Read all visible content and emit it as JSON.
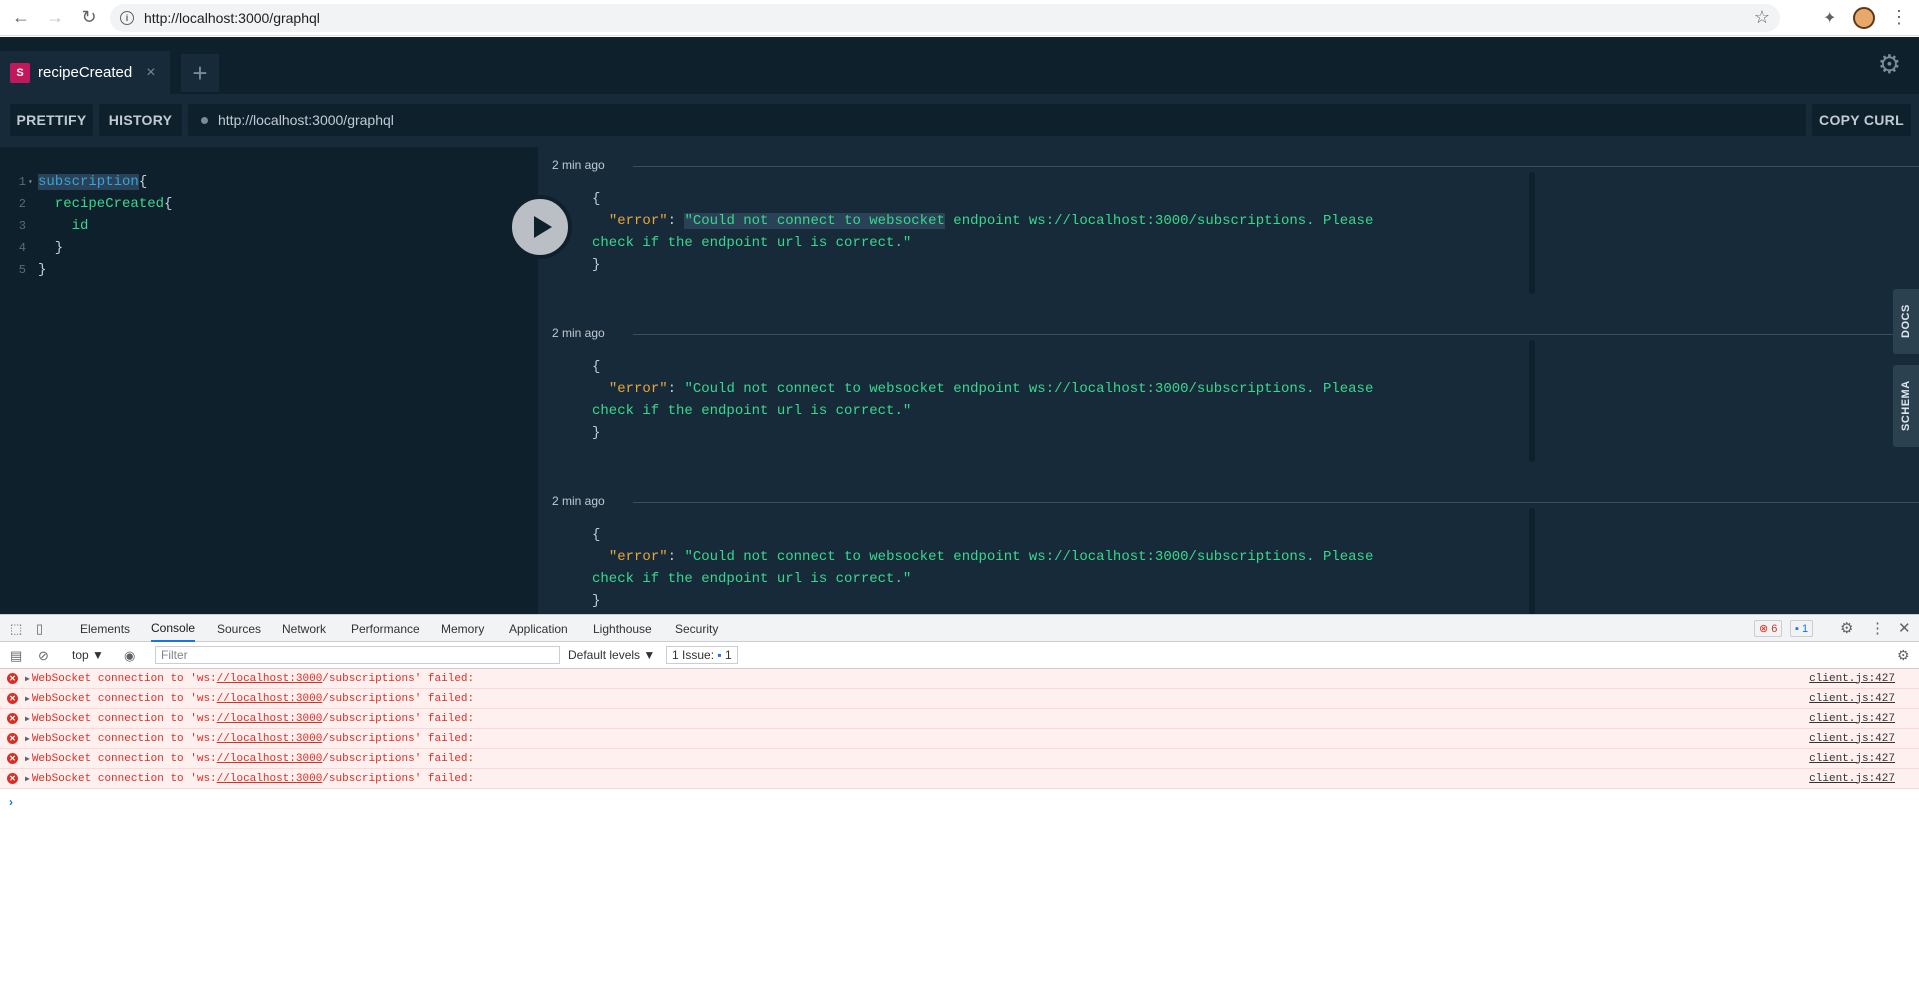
{
  "browser": {
    "back": "←",
    "forward": "→",
    "reload": "↻",
    "url": "http://localhost:3000/graphql",
    "star": "☆",
    "extensions": "✦",
    "menu": "⋮"
  },
  "playground": {
    "tab": {
      "badge": "S",
      "title": "recipeCreated",
      "close": "×"
    },
    "add_tab": "+",
    "settings": "⚙",
    "toolbar": {
      "prettify": "PRETTIFY",
      "history": "HISTORY",
      "endpoint": "http://localhost:3000/graphql",
      "copy_curl": "COPY CURL"
    },
    "editor": {
      "lines": [
        {
          "n": "1",
          "a": "subscription",
          "b": "{"
        },
        {
          "n": "2",
          "a": "  recipeCreated",
          "b": "{"
        },
        {
          "n": "3",
          "a": "    id",
          "b": ""
        },
        {
          "n": "4",
          "a": "  }",
          "b": ""
        },
        {
          "n": "5",
          "a": "}",
          "b": ""
        }
      ],
      "fold": "▾"
    },
    "results": [
      {
        "time": "2 min ago",
        "open": "{",
        "key": "\"error\"",
        "colon": ": ",
        "msg_part1": "\"Could not connect to websocket",
        "msg_part2": " endpoint ws://localhost:3000/subscriptions. Please",
        "msg_line2": "check if the endpoint url is correct.\"",
        "close": "}"
      },
      {
        "time": "2 min ago",
        "open": "{",
        "key": "\"error\"",
        "colon": ": ",
        "msg_part1": "\"Could not connect to websocket",
        "msg_part2": " endpoint ws://localhost:3000/subscriptions. Please",
        "msg_line2": "check if the endpoint url is correct.\"",
        "close": "}"
      },
      {
        "time": "2 min ago",
        "open": "{",
        "key": "\"error\"",
        "colon": ": ",
        "msg_part1": "\"Could not connect to websocket",
        "msg_part2": " endpoint ws://localhost:3000/subscriptions. Please",
        "msg_line2": "check if the endpoint url is correct.\"",
        "close": "}"
      }
    ],
    "side_tabs": {
      "docs": "DOCS",
      "schema": "SCHEMA"
    }
  },
  "devtools": {
    "tabs": [
      "Elements",
      "Console",
      "Sources",
      "Network",
      "Performance",
      "Memory",
      "Application",
      "Lighthouse",
      "Security"
    ],
    "active_tab": "Console",
    "error_count": "6",
    "message_count": "1",
    "context": "top ▼",
    "filter_placeholder": "Filter",
    "levels": "Default levels ▼",
    "issues_label": "1 Issue:",
    "issues_count": "1",
    "logs": [
      {
        "pre": "WebSocket connection to 'ws:",
        "link": "//localhost:3000",
        "post": "/subscriptions' failed:",
        "src": "client.js:427"
      },
      {
        "pre": "WebSocket connection to 'ws:",
        "link": "//localhost:3000",
        "post": "/subscriptions' failed:",
        "src": "client.js:427"
      },
      {
        "pre": "WebSocket connection to 'ws:",
        "link": "//localhost:3000",
        "post": "/subscriptions' failed:",
        "src": "client.js:427"
      },
      {
        "pre": "WebSocket connection to 'ws:",
        "link": "//localhost:3000",
        "post": "/subscriptions' failed:",
        "src": "client.js:427"
      },
      {
        "pre": "WebSocket connection to 'ws:",
        "link": "//localhost:3000",
        "post": "/subscriptions' failed:",
        "src": "client.js:427"
      },
      {
        "pre": "WebSocket connection to 'ws:",
        "link": "//localhost:3000",
        "post": "/subscriptions' failed:",
        "src": "client.js:427"
      }
    ],
    "prompt": "›"
  },
  "colors": {
    "playground_bg": "#172a3a",
    "editor_bg": "#0f202d",
    "string": "#3bd88b",
    "key": "#e8a73d",
    "error_red": "#d93025"
  }
}
